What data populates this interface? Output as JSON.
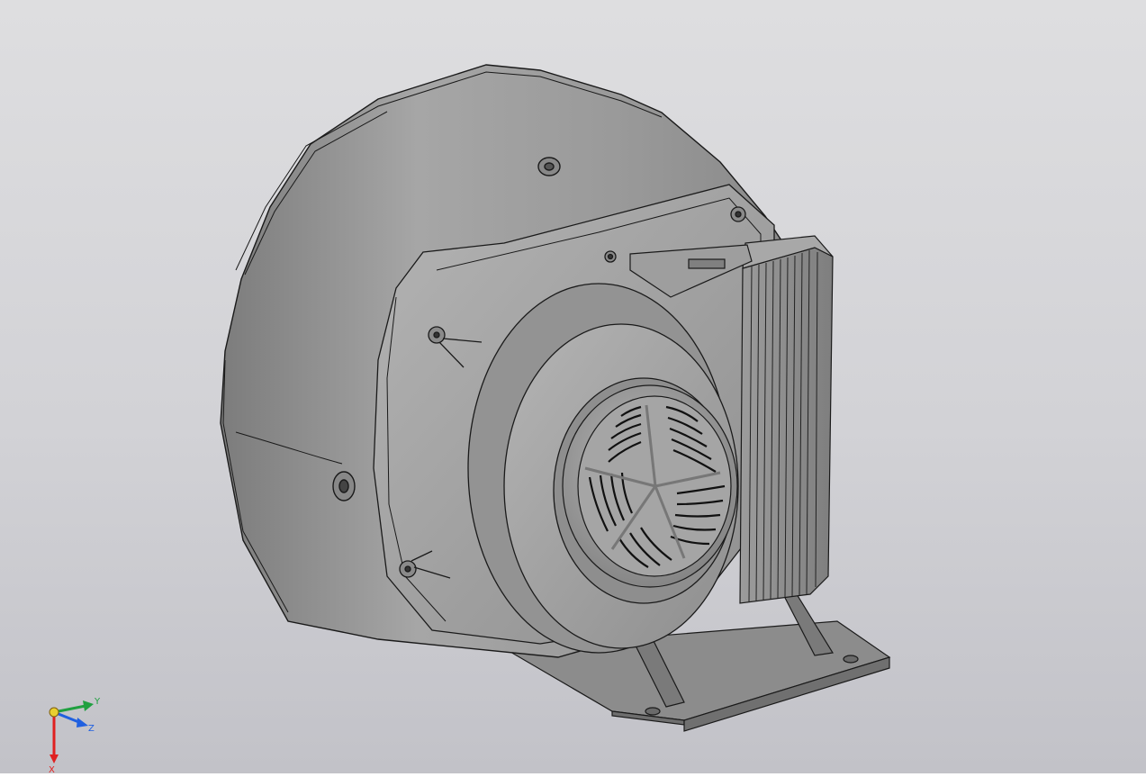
{
  "viewport": {
    "background_top": "#dedee0",
    "background_bottom": "#c2c2c8",
    "model_color": "#9a9a9a",
    "edge_color": "#1a1a1a"
  },
  "triad": {
    "x_label": "X",
    "y_label": "Y",
    "z_label": "Z",
    "x_color": "#e02020",
    "y_color": "#20a040",
    "z_color": "#2060e0",
    "origin_color": "#e8d030"
  }
}
